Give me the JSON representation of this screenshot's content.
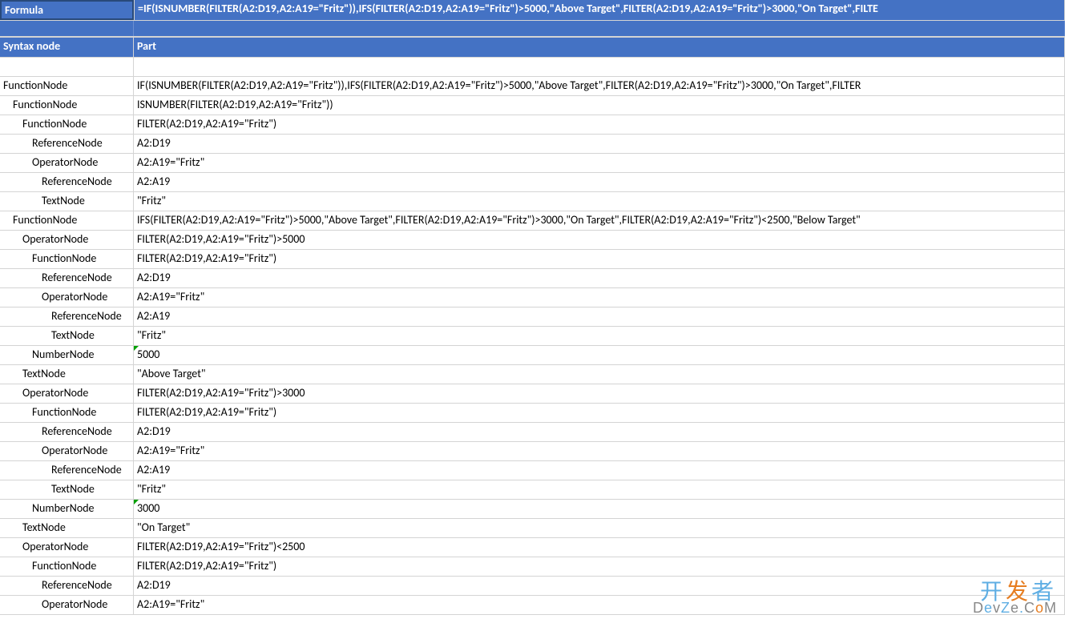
{
  "header": {
    "col1": "Formula",
    "col2": "=IF(ISNUMBER(FILTER(A2:D19,A2:A19=\"Fritz\")),IFS(FILTER(A2:D19,A2:A19=\"Fritz\")>5000,\"Above Target\",FILTER(A2:D19,A2:A19=\"Fritz\")>3000,\"On Target\",FILTE"
  },
  "subhead": {
    "col1": "Syntax node",
    "col2": "Part"
  },
  "rows": [
    {
      "indent": 0,
      "name": "",
      "part": ""
    },
    {
      "indent": 0,
      "name": "FunctionNode",
      "part": "IF(ISNUMBER(FILTER(A2:D19,A2:A19=\"Fritz\")),IFS(FILTER(A2:D19,A2:A19=\"Fritz\")>5000,\"Above Target\",FILTER(A2:D19,A2:A19=\"Fritz\")>3000,\"On Target\",FILTER"
    },
    {
      "indent": 1,
      "name": "FunctionNode",
      "part": "ISNUMBER(FILTER(A2:D19,A2:A19=\"Fritz\"))"
    },
    {
      "indent": 2,
      "name": "FunctionNode",
      "part": "FILTER(A2:D19,A2:A19=\"Fritz\")"
    },
    {
      "indent": 3,
      "name": "ReferenceNode",
      "part": "A2:D19"
    },
    {
      "indent": 3,
      "name": "OperatorNode",
      "part": "A2:A19=\"Fritz\""
    },
    {
      "indent": 4,
      "name": "ReferenceNode",
      "part": "A2:A19"
    },
    {
      "indent": 4,
      "name": "TextNode",
      "part": "\"Fritz\""
    },
    {
      "indent": 1,
      "name": "FunctionNode",
      "part": "IFS(FILTER(A2:D19,A2:A19=\"Fritz\")>5000,\"Above Target\",FILTER(A2:D19,A2:A19=\"Fritz\")>3000,\"On Target\",FILTER(A2:D19,A2:A19=\"Fritz\")<2500,\"Below Target\""
    },
    {
      "indent": 2,
      "name": "OperatorNode",
      "part": "FILTER(A2:D19,A2:A19=\"Fritz\")>5000"
    },
    {
      "indent": 3,
      "name": "FunctionNode",
      "part": "FILTER(A2:D19,A2:A19=\"Fritz\")"
    },
    {
      "indent": 4,
      "name": "ReferenceNode",
      "part": "A2:D19"
    },
    {
      "indent": 4,
      "name": "OperatorNode",
      "part": "A2:A19=\"Fritz\""
    },
    {
      "indent": 5,
      "name": "ReferenceNode",
      "part": "A2:A19"
    },
    {
      "indent": 5,
      "name": "TextNode",
      "part": "\"Fritz\""
    },
    {
      "indent": 3,
      "name": "NumberNode",
      "part": "5000",
      "tri": true
    },
    {
      "indent": 2,
      "name": "TextNode",
      "part": "\"Above Target\""
    },
    {
      "indent": 2,
      "name": "OperatorNode",
      "part": "FILTER(A2:D19,A2:A19=\"Fritz\")>3000"
    },
    {
      "indent": 3,
      "name": "FunctionNode",
      "part": "FILTER(A2:D19,A2:A19=\"Fritz\")"
    },
    {
      "indent": 4,
      "name": "ReferenceNode",
      "part": "A2:D19"
    },
    {
      "indent": 4,
      "name": "OperatorNode",
      "part": "A2:A19=\"Fritz\""
    },
    {
      "indent": 5,
      "name": "ReferenceNode",
      "part": "A2:A19"
    },
    {
      "indent": 5,
      "name": "TextNode",
      "part": "\"Fritz\""
    },
    {
      "indent": 3,
      "name": "NumberNode",
      "part": "3000",
      "tri": true
    },
    {
      "indent": 2,
      "name": "TextNode",
      "part": "\"On Target\""
    },
    {
      "indent": 2,
      "name": "OperatorNode",
      "part": "FILTER(A2:D19,A2:A19=\"Fritz\")<2500"
    },
    {
      "indent": 3,
      "name": "FunctionNode",
      "part": "FILTER(A2:D19,A2:A19=\"Fritz\")"
    },
    {
      "indent": 4,
      "name": "ReferenceNode",
      "part": "A2:D19"
    },
    {
      "indent": 4,
      "name": "OperatorNode",
      "part": "A2:A19=\"Fritz\""
    }
  ],
  "watermark": {
    "line1_pre": "开",
    "line1_mid": "发",
    "line1_post": "者",
    "line2": "DevZe.CoM"
  }
}
